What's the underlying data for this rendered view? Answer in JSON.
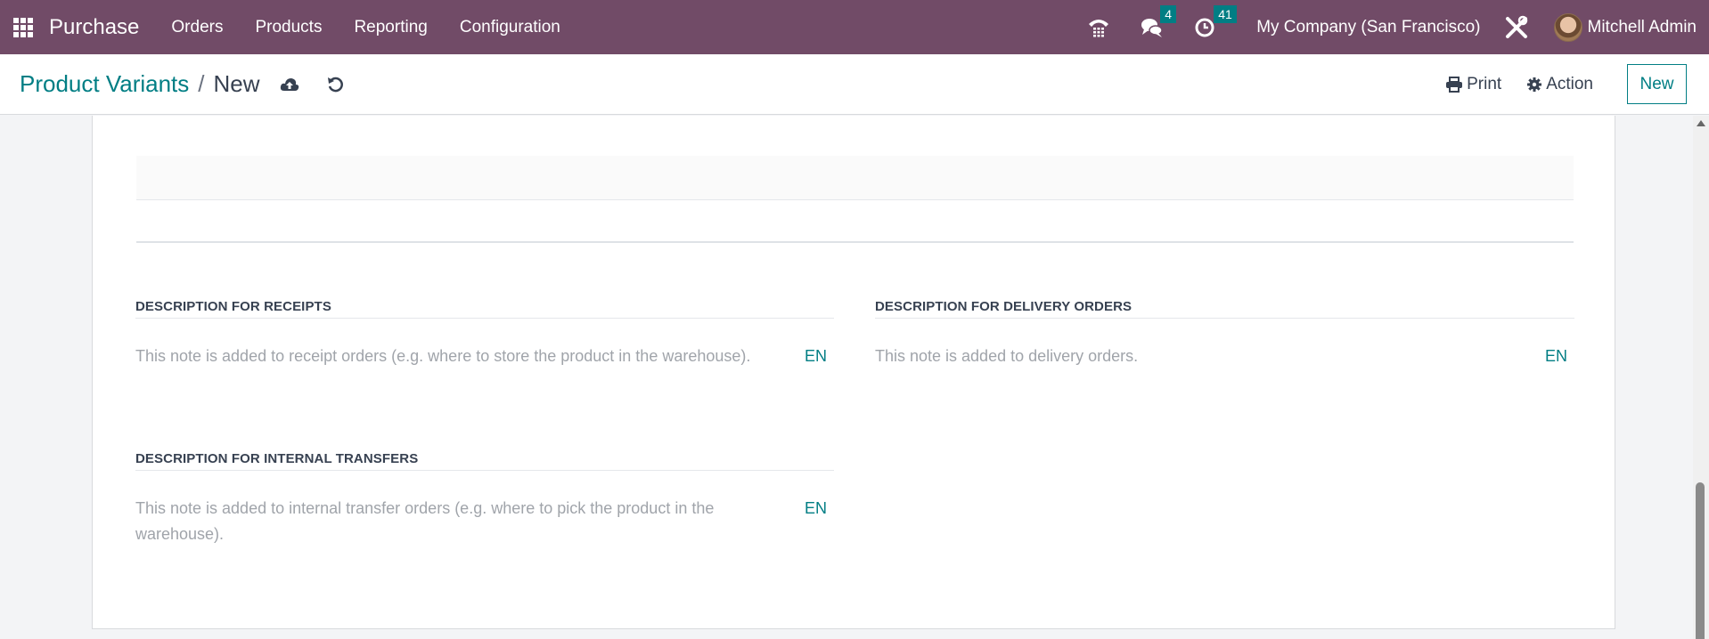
{
  "navbar": {
    "app_name": "Purchase",
    "menu": [
      "Orders",
      "Products",
      "Reporting",
      "Configuration"
    ],
    "icons": [
      "apps-grid-icon",
      "phone-icon",
      "chat-icon",
      "activity-clock-icon",
      "tools-icon"
    ],
    "messages_badge": "4",
    "activities_badge": "41",
    "company": "My Company (San Francisco)",
    "user": "Mitchell Admin"
  },
  "control_panel": {
    "breadcrumb_parent": "Product Variants",
    "breadcrumb_separator": "/",
    "breadcrumb_current": "New",
    "print_label": "Print",
    "action_label": "Action",
    "new_label": "New"
  },
  "form": {
    "sections": [
      {
        "title": "DESCRIPTION FOR RECEIPTS",
        "placeholder": "This note is added to receipt orders (e.g. where to store the product in the warehouse).",
        "lang": "EN"
      },
      {
        "title": "DESCRIPTION FOR DELIVERY ORDERS",
        "placeholder": "This note is added to delivery orders.",
        "lang": "EN"
      },
      {
        "title": "DESCRIPTION FOR INTERNAL TRANSFERS",
        "placeholder": "This note is added to internal transfer orders (e.g. where to pick the product in the warehouse).",
        "lang": "EN"
      }
    ]
  },
  "colors": {
    "navbar": "#714b67",
    "accent": "#017e84"
  }
}
